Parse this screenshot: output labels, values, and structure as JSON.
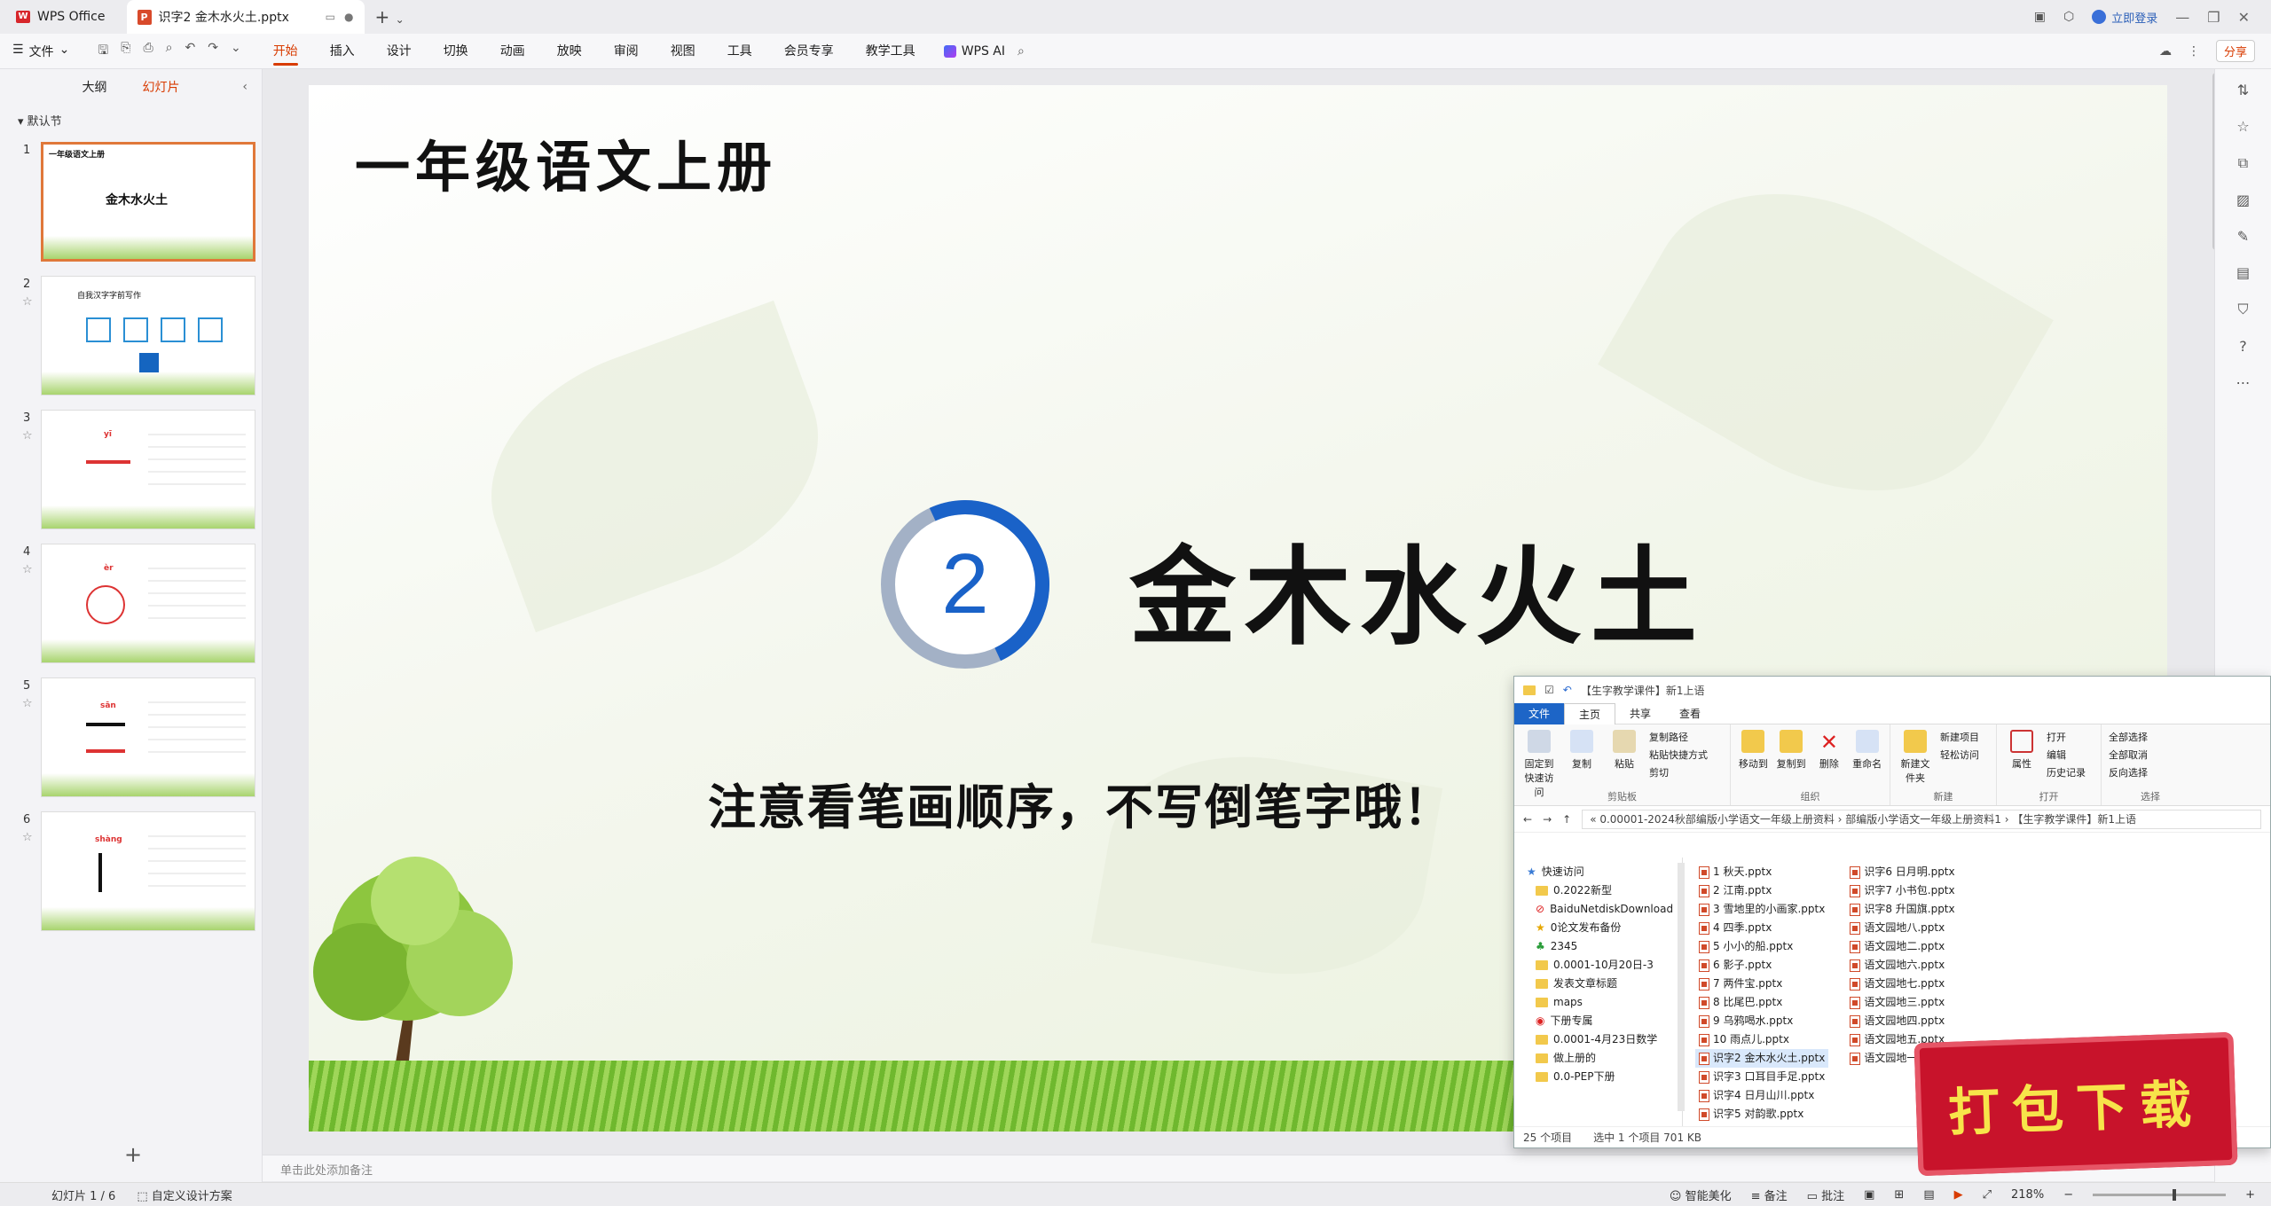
{
  "titlebar": {
    "app_name": "WPS Office",
    "doc_tab": "识字2 金木水火土.pptx",
    "login": "立即登录"
  },
  "ribbon": {
    "file_menu": "文件",
    "tabs": [
      "开始",
      "插入",
      "设计",
      "切换",
      "动画",
      "放映",
      "审阅",
      "视图",
      "工具",
      "会员专享",
      "教学工具"
    ],
    "active_tab": "开始",
    "ai": "WPS AI",
    "share": "分享"
  },
  "leftpanel": {
    "tabs": [
      "大纲",
      "幻灯片"
    ],
    "active_tab": "幻灯片",
    "section": "默认节",
    "thumbs": [
      {
        "num": "1",
        "title": "一年级语文上册",
        "main": "金木水火土"
      },
      {
        "num": "2",
        "title": "自我汉字字前写作"
      },
      {
        "num": "3",
        "title": "yī"
      },
      {
        "num": "4",
        "title": "èr"
      },
      {
        "num": "5",
        "title": "sān"
      },
      {
        "num": "6",
        "title": "shàng"
      }
    ]
  },
  "slide": {
    "title": "一年级语文上册",
    "number": "2",
    "main_title": "金木水火土",
    "subtitle": "注意看笔画顺序，不写倒笔字哦！"
  },
  "notes_placeholder": "单击此处添加备注",
  "statusbar": {
    "slide_count": "幻灯片 1 / 6",
    "design": "自定义设计方案",
    "beautify": "智能美化",
    "notes": "备注",
    "comments": "批注",
    "zoom": "218%"
  },
  "explorer": {
    "title": "【生字教学课件】新1上语",
    "tabs": [
      "文件",
      "主页",
      "共享",
      "查看"
    ],
    "groups": {
      "clipboard": {
        "name": "剪贴板",
        "pin": "固定到快速访问",
        "copy": "复制",
        "paste": "粘贴",
        "copy_path": "复制路径",
        "paste_shortcut": "粘贴快捷方式",
        "cut": "剪切"
      },
      "organize": {
        "name": "组织",
        "move": "移动到",
        "copyto": "复制到",
        "delete": "删除",
        "rename": "重命名"
      },
      "new": {
        "name": "新建",
        "folder": "新建文件夹",
        "item": "新建项目",
        "easy": "轻松访问"
      },
      "open": {
        "name": "打开",
        "props": "属性",
        "open": "打开",
        "edit": "编辑",
        "history": "历史记录"
      },
      "select": {
        "name": "选择",
        "all": "全部选择",
        "none": "全部取消",
        "invert": "反向选择"
      }
    },
    "path": "« 0.00001-2024秋部编版小学语文一年级上册资料 › 部编版小学语文一年级上册资料1 › 【生字教学课件】新1上语",
    "nav": [
      "快速访问",
      "0.2022新型",
      "BaiduNetdiskDownload",
      "0论文发布备份",
      "2345",
      "0.0001-10月20日-3",
      "发表文章标题",
      "maps",
      "下册专属",
      "0.0001-4月23日数学",
      "做上册的",
      "0.0-PEP下册"
    ],
    "files_col1": [
      "1 秋天.pptx",
      "2 江南.pptx",
      "3 雪地里的小画家.pptx",
      "4 四季.pptx",
      "5 小小的船.pptx",
      "6 影子.pptx",
      "7 两件宝.pptx",
      "8 比尾巴.pptx",
      "9 乌鸦喝水.pptx",
      "10 雨点儿.pptx",
      "识字2 金木水火土.pptx",
      "识字3 口耳目手足.pptx",
      "识字4 日月山川.pptx",
      "识字5 对韵歌.pptx"
    ],
    "files_col2": [
      "识字6 日月明.pptx",
      "识字7 小书包.pptx",
      "识字8 升国旗.pptx",
      "语文园地八.pptx",
      "语文园地二.pptx",
      "语文园地六.pptx",
      "语文园地七.pptx",
      "语文园地三.pptx",
      "语文园地四.pptx",
      "语文园地五.pptx",
      "语文园地一.pptx"
    ],
    "selected": "识字2 金木水火土.pptx",
    "status_count": "25 个项目",
    "status_sel": "选中 1 个项目  701 KB"
  },
  "badge": "打包下载"
}
